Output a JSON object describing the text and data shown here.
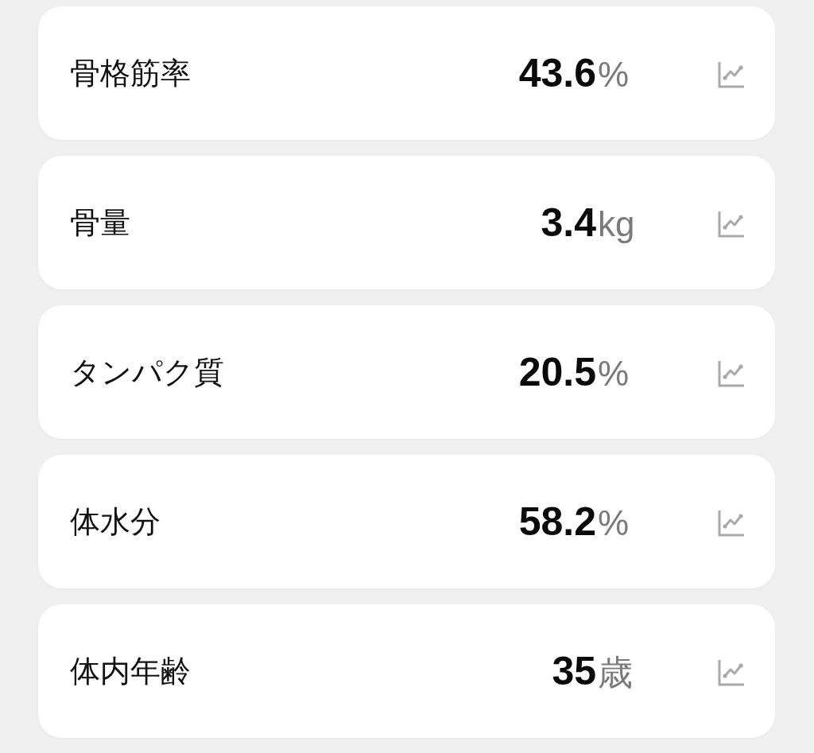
{
  "metrics": [
    {
      "label": "骨格筋率",
      "value": "43.6",
      "unit": "%"
    },
    {
      "label": "骨量",
      "value": "3.4",
      "unit": "kg"
    },
    {
      "label": "タンパク質",
      "value": "20.5",
      "unit": "%"
    },
    {
      "label": "体水分",
      "value": "58.2",
      "unit": "%"
    },
    {
      "label": "体内年齢",
      "value": "35",
      "unit": "歳"
    }
  ]
}
